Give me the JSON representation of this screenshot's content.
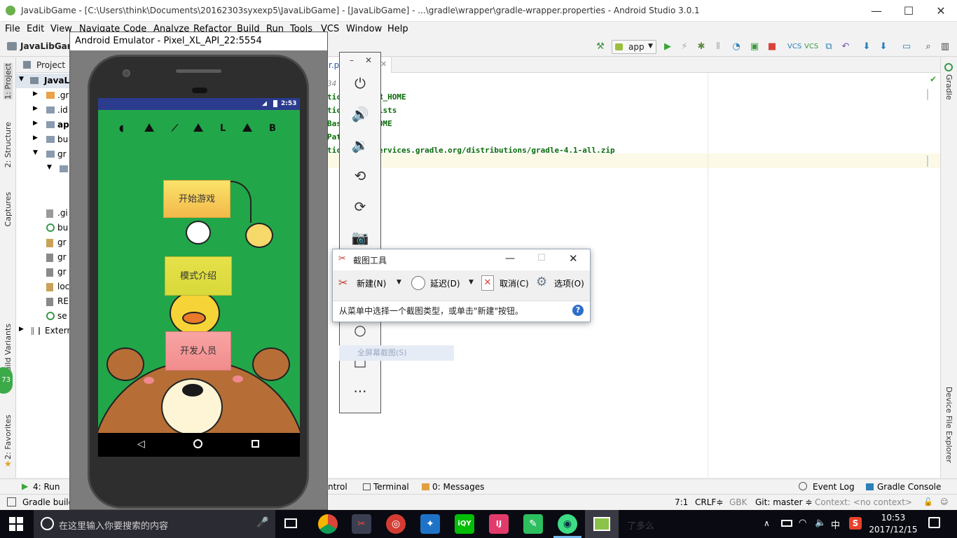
{
  "window": {
    "title": "JavaLibGame - [C:\\Users\\think\\Documents\\20162303syxexp5\\JavaLibGame] - [JavaLibGame] - ...\\gradle\\wrapper\\gradle-wrapper.properties - Android Studio 3.0.1",
    "minimize": "—",
    "maximize": "☐",
    "close": "✕"
  },
  "menu": [
    "File",
    "Edit",
    "View",
    "Navigate",
    "Code",
    "Analyze",
    "Refactor",
    "Build",
    "Run",
    "Tools",
    "VCS",
    "Window",
    "Help"
  ],
  "toolbar": {
    "breadcrumb": "JavaLibGame",
    "run_config": "app"
  },
  "left_tools": {
    "project": "1: Project",
    "structure": "2: Structure",
    "captures": "Captures",
    "variants": "Build Variants",
    "favorites": "2: Favorites",
    "badge": "73"
  },
  "project_panel": {
    "header": "Project",
    "items": [
      "JavaL",
      ".gr",
      ".id",
      "ap",
      "bu",
      "gr",
      "",
      ".gi",
      "bu",
      "gr",
      "gr",
      "gr",
      "loc",
      "RE",
      "se",
      "Extern"
    ]
  },
  "editor": {
    "tab": "r.p",
    "lines": [
      "34 ST 2017",
      "tic DLE_USER_HOME",
      "tic apper/dists",
      "Bas _USER_HOME",
      "Pat r/dists",
      "tic ps\\://services.gradle.org/distributions/gradle-4.1-all.zip"
    ]
  },
  "right_tools": {
    "gradle": "Gradle",
    "device_explorer": "Device File Explorer"
  },
  "emulator": {
    "title": "Android Emulator - Pixel_XL_API_22:5554",
    "time": "2:53",
    "game_letters": [
      "L",
      "B"
    ],
    "start_btn": "开始游戏",
    "mode_btn": "模式介绍",
    "dev_btn": "开发人员",
    "screenshot_label": "全屏幕截图(S)"
  },
  "snipping": {
    "title": "截图工具",
    "new": "新建(N)",
    "delay": "延迟(D)",
    "cancel": "取消(C)",
    "options": "选项(O)",
    "message": "从菜单中选择一个截图类型，或单击\"新建\"按钮。",
    "help": "?"
  },
  "bottom_tabs": {
    "run": "4: Run",
    "control": "ntrol",
    "terminal": "Terminal",
    "messages": "0: Messages",
    "event_log": "Event Log",
    "gradle_console": "Gradle Console"
  },
  "status": {
    "left": "Gradle build",
    "position": "7:1",
    "line_sep": "CRLF≑",
    "encoding": "GBK",
    "git": "Git: master ≑",
    "context": "Context: <no context>"
  },
  "taskbar": {
    "search": "在这里输入你要搜索的内容",
    "tray_ime": "中",
    "tray_s": "S",
    "time": "10:53",
    "date": "2017/12/15",
    "faded_text": "了多么"
  }
}
